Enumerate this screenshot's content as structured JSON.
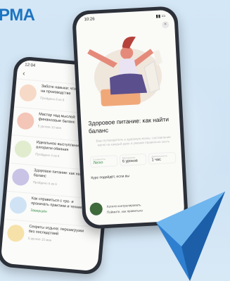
{
  "brand": {
    "text": "РМА"
  },
  "colors": {
    "brand": "#1d74c0",
    "accent_blue": "#3b97df",
    "green": "#2e8a40"
  },
  "back_phone": {
    "status_time": "12:04",
    "back_glyph": "‹",
    "items": [
      {
        "title": "Заботе навыки: что от важно на производстве",
        "meta": "Пройдено 8 из 8"
      },
      {
        "title": "Мастер над мыслей: То финансовые баланс",
        "meta": "5 уроков  10 мин"
      },
      {
        "title": "Идеальное выступление: алгоритм обаяния",
        "meta": "Пройдено 4 из 6"
      },
      {
        "title": "Здоровое питание: как найти баланс",
        "meta": "Пройдено 6 из 6"
      },
      {
        "title": "Как справиться с тре- и прокачать практики и техники",
        "done": "Завершён"
      },
      {
        "title": "Секреты отдыха: перезагрузки без последствий",
        "meta": "5 уроков  15 мин"
      }
    ]
  },
  "front_phone": {
    "status_time": "10:26",
    "close_glyph": "×",
    "title": "Здоровое питание: как найти баланс",
    "description": "Ваш путеводитель в здоровую жизнь: составление меню на каждый день и умение правильно сесть",
    "stats": [
      {
        "label": "Сложность",
        "value": "Легко",
        "green": true
      },
      {
        "label": "Материалы",
        "value": "6 уроков",
        "green": false
      },
      {
        "label": "Длительность",
        "value": "1 час",
        "green": false
      }
    ],
    "who_heading": "Курс подойдёт, если вы",
    "criteria": [
      "Хотите контролировать",
      "Поймите, как правильно"
    ]
  }
}
